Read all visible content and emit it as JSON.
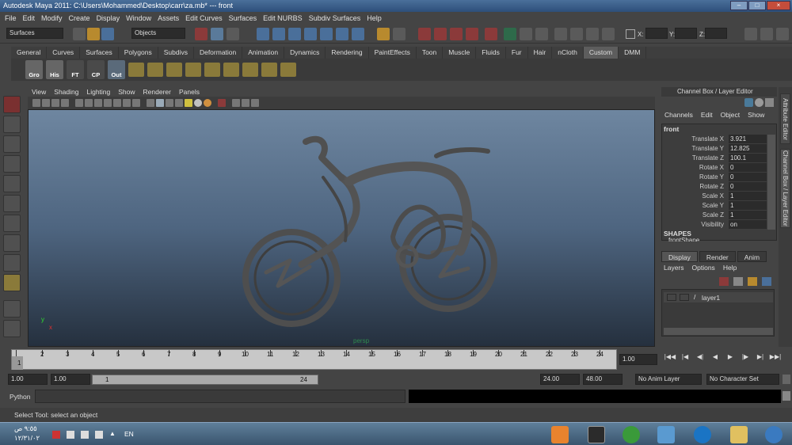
{
  "window": {
    "title": "Autodesk Maya 2011: C:\\Users\\Mohammed\\Desktop\\carr\\za.mb* --- front"
  },
  "menu": [
    "File",
    "Edit",
    "Modify",
    "Create",
    "Display",
    "Window",
    "Assets",
    "Edit Curves",
    "Surfaces",
    "Edit NURBS",
    "Subdiv Surfaces",
    "Help"
  ],
  "status_line": {
    "menu_set": "Surfaces",
    "selection_mode": "Objects",
    "x_label": "X:",
    "y_label": "Y:",
    "z_label": "Z:"
  },
  "shelf_tabs": [
    "General",
    "Curves",
    "Surfaces",
    "Polygons",
    "Subdivs",
    "Deformation",
    "Animation",
    "Dynamics",
    "Rendering",
    "PaintEffects",
    "Toon",
    "Muscle",
    "Fluids",
    "Fur",
    "Hair",
    "nCloth",
    "Custom",
    "DMM"
  ],
  "shelf_active": "Custom",
  "shelf_buttons": [
    "Gro",
    "His",
    "FT",
    "CP",
    "Out"
  ],
  "view_menu": [
    "View",
    "Shading",
    "Lighting",
    "Show",
    "Renderer",
    "Panels"
  ],
  "viewport": {
    "camera_label": "persp",
    "axis_x": "x",
    "axis_y": "y"
  },
  "channel_box": {
    "header": "Channel Box / Layer Editor",
    "menu": [
      "Channels",
      "Edit",
      "Object",
      "Show"
    ],
    "object": "front",
    "attributes": [
      {
        "name": "Translate X",
        "value": "3.921"
      },
      {
        "name": "Translate Y",
        "value": "12.825"
      },
      {
        "name": "Translate Z",
        "value": "100.1"
      },
      {
        "name": "Rotate X",
        "value": "0"
      },
      {
        "name": "Rotate Y",
        "value": "0"
      },
      {
        "name": "Rotate Z",
        "value": "0"
      },
      {
        "name": "Scale X",
        "value": "1"
      },
      {
        "name": "Scale Y",
        "value": "1"
      },
      {
        "name": "Scale Z",
        "value": "1"
      },
      {
        "name": "Visibility",
        "value": "on"
      }
    ],
    "shapes_label": "SHAPES",
    "shape_name": "frontShape"
  },
  "side_tabs": [
    "Attribute Editor",
    "Channel Box / Layer Editor"
  ],
  "layer_editor": {
    "tabs": [
      "Display",
      "Render",
      "Anim"
    ],
    "active_tab": "Display",
    "menu": [
      "Layers",
      "Options",
      "Help"
    ],
    "layers": [
      "layer1"
    ]
  },
  "timeline": {
    "ticks": [
      "1",
      "2",
      "3",
      "4",
      "5",
      "6",
      "7",
      "8",
      "9",
      "10",
      "11",
      "12",
      "13",
      "14",
      "15",
      "16",
      "17",
      "18",
      "19",
      "20",
      "21",
      "22",
      "23",
      "24"
    ],
    "current_frame": "1.00"
  },
  "range": {
    "start_time": "1.00",
    "playback_start": "1.00",
    "slider_start": "1",
    "slider_end": "24",
    "playback_end": "24.00",
    "end_time": "48.00",
    "anim_layer": "No Anim Layer",
    "character_set": "No Character Set"
  },
  "command_line": {
    "label": "Python"
  },
  "help_line": "Select Tool: select an object",
  "taskbar": {
    "time": "٩:٥٥ ص",
    "date": "١٢/٣١/٠٢",
    "lang": "EN"
  },
  "colors": {
    "accent": "#5d5d5d",
    "viewport_top": "#6e86a0",
    "viewport_bottom": "#25303e",
    "title_bar": "#3a5c86"
  }
}
